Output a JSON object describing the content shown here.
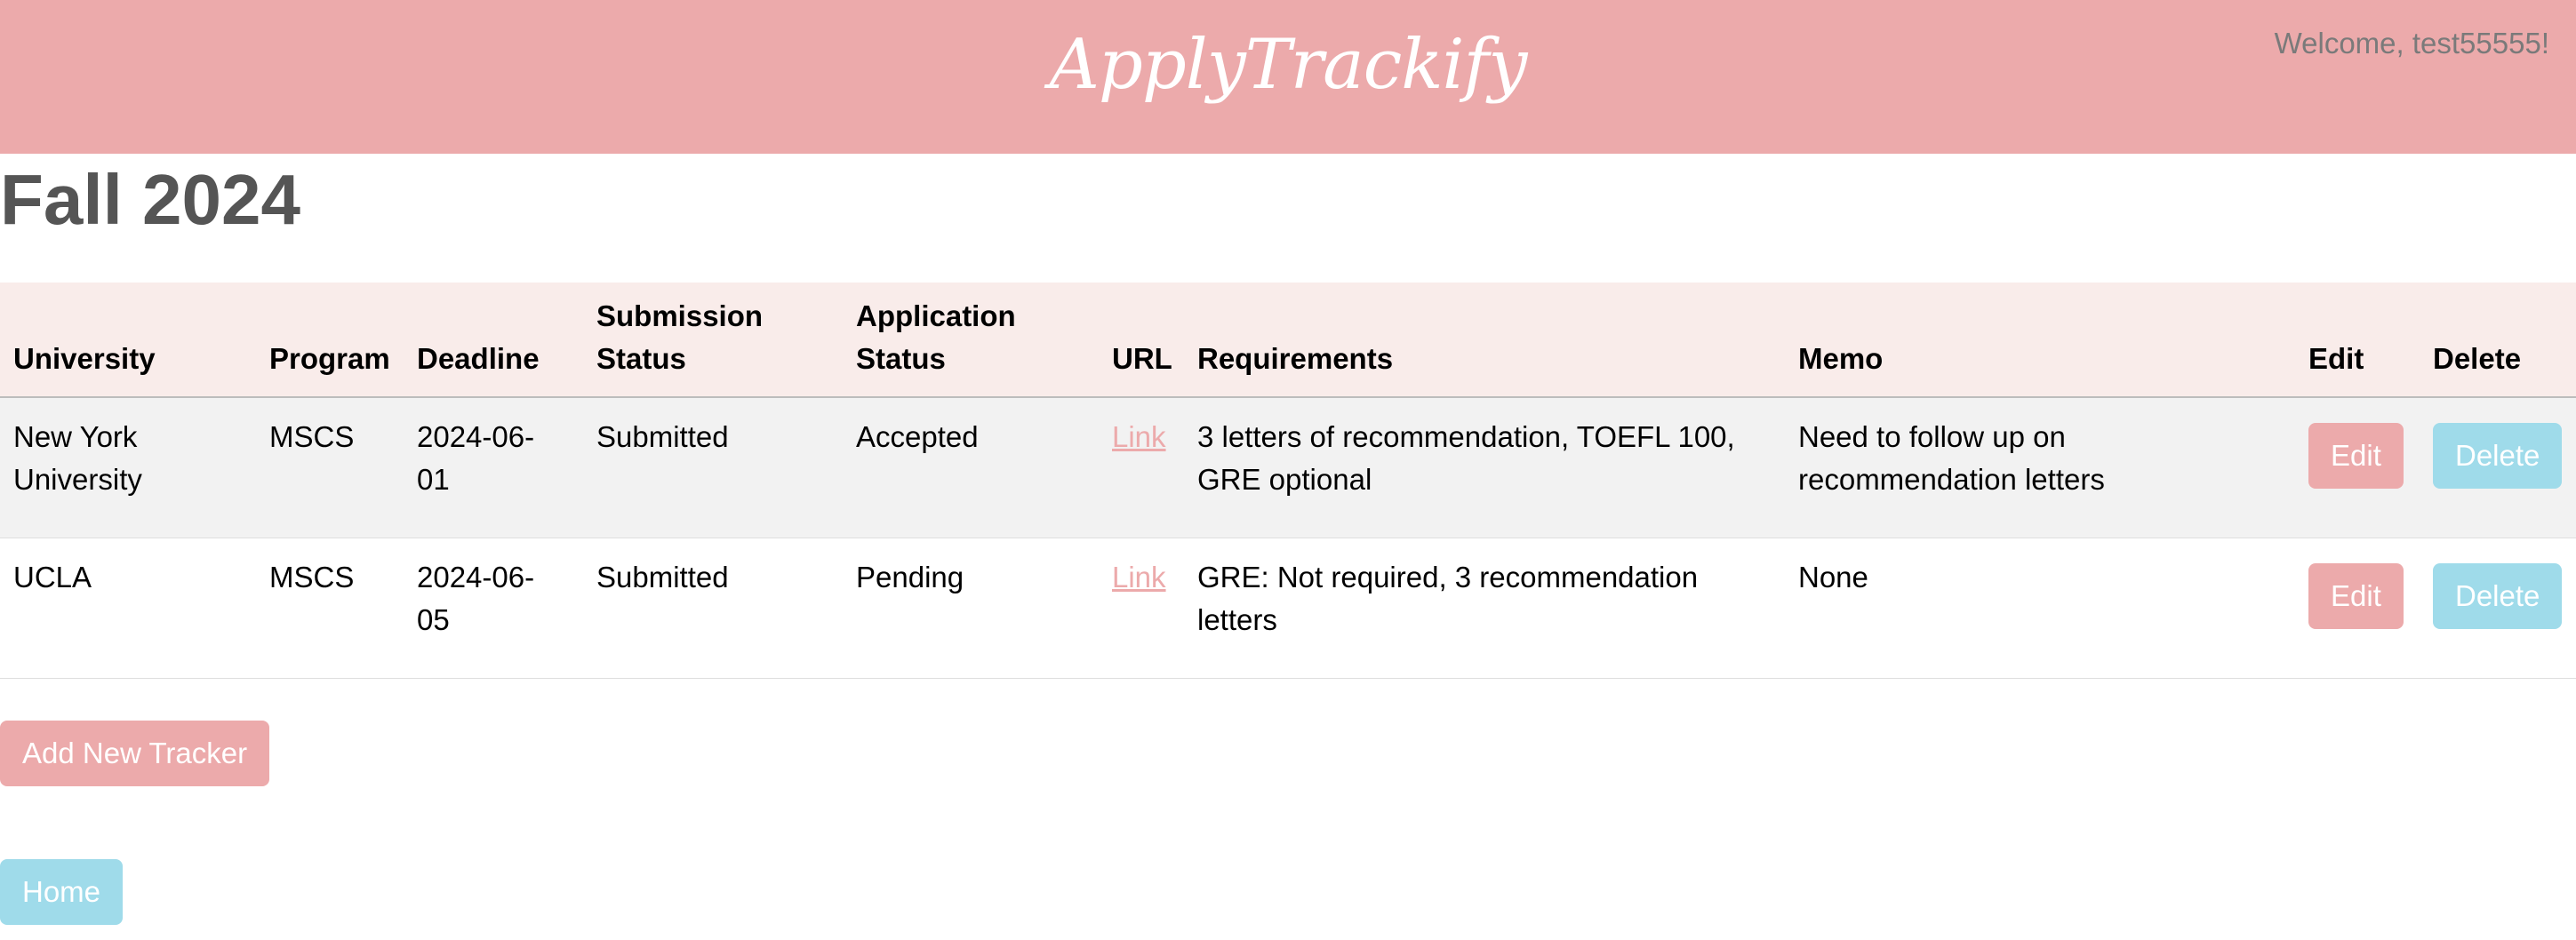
{
  "header": {
    "logo_text": "ApplyTrackify",
    "welcome_text": "Welcome, test55555!"
  },
  "page": {
    "title": "Fall 2024"
  },
  "table": {
    "headers": {
      "university": "University",
      "program": "Program",
      "deadline": "Deadline",
      "submission_status_1": "Submission",
      "submission_status_2": "Status",
      "application_status_1": "Application",
      "application_status_2": "Status",
      "url": "URL",
      "requirements": "Requirements",
      "memo": "Memo",
      "edit": "Edit",
      "delete": "Delete"
    },
    "rows": [
      {
        "university_1": "New York",
        "university_2": "University",
        "program": "MSCS",
        "deadline_1": "2024-06-",
        "deadline_2": "01",
        "submission_status": "Submitted",
        "application_status": "Accepted",
        "url_label": "Link",
        "requirements_1": "3 letters of recommendation, TOEFL 100,",
        "requirements_2": "GRE optional",
        "memo_1": "Need to follow up on",
        "memo_2": "recommendation letters",
        "edit_label": "Edit",
        "delete_label": "Delete"
      },
      {
        "university_1": "UCLA",
        "university_2": "",
        "program": "MSCS",
        "deadline_1": "2024-06-",
        "deadline_2": "05",
        "submission_status": "Submitted",
        "application_status": "Pending",
        "url_label": "Link",
        "requirements_1": "GRE: Not required, 3 recommendation",
        "requirements_2": "letters",
        "memo_1": "None",
        "memo_2": "",
        "edit_label": "Edit",
        "delete_label": "Delete"
      }
    ]
  },
  "actions": {
    "add_label": "Add New Tracker",
    "home_label": "Home"
  },
  "colors": {
    "brand_pink": "#ecaaab",
    "accent_blue": "#9fdbea",
    "header_row_bg": "#f9ecea"
  }
}
